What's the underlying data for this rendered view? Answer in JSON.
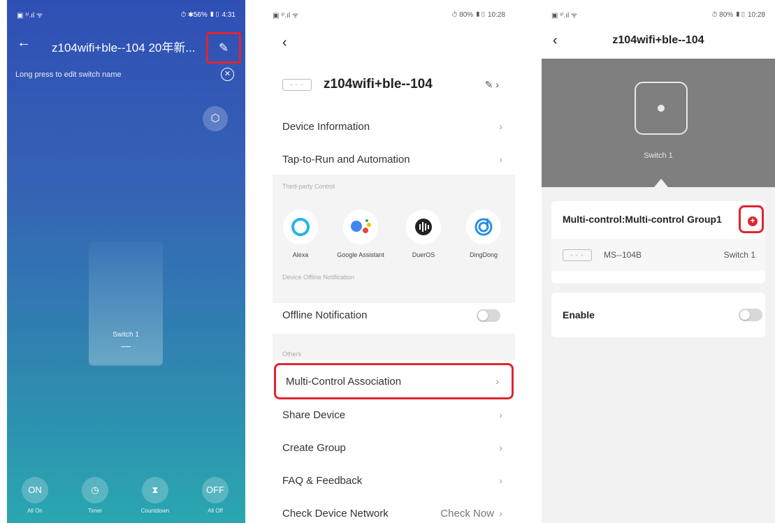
{
  "phone1": {
    "status_left": "▣ ˢⁱ.ıl ᯤ",
    "status_right": "⏱ ✱56% ▮▯ 4:31",
    "title": "z104wifi+ble--104 20年新...",
    "hint": "Long press to edit switch name",
    "switch_label": "Switch 1",
    "controls": [
      {
        "icon": "ON",
        "label": "All On"
      },
      {
        "icon": "◷",
        "label": "Timer"
      },
      {
        "icon": "⧗",
        "label": "Countdown"
      },
      {
        "icon": "OFF",
        "label": "All Off"
      }
    ],
    "colors": {
      "gradient_top": "#2f4fb5",
      "gradient_bottom": "#2aa7b0",
      "highlight": "#e0252f"
    }
  },
  "phone2": {
    "status_left": "▣ ˢⁱ.ıl ᯤ",
    "status_right": "⏱ 80% ▮▯ 10:28",
    "device_name": "z104wifi+ble--104",
    "rows_top": [
      {
        "label": "Device Information"
      },
      {
        "label": "Tap-to-Run and Automation"
      }
    ],
    "third_party_title": "Third-party Control",
    "third_party": [
      {
        "label": "Alexa"
      },
      {
        "label": "Google Assistant"
      },
      {
        "label": "DuerOS"
      },
      {
        "label": "DingDong"
      }
    ],
    "offline_title": "Device Offline Notification",
    "offline_row": "Offline Notification",
    "others_title": "Others",
    "rows_others": [
      {
        "label": "Multi-Control Association"
      },
      {
        "label": "Share Device"
      },
      {
        "label": "Create Group"
      },
      {
        "label": "FAQ & Feedback"
      },
      {
        "label": "Check Device Network",
        "value": "Check Now"
      }
    ]
  },
  "phone3": {
    "status_left": "▣ ˢⁱ.ıl ᯤ",
    "status_right": "⏱ 80% ▮▯ 10:28",
    "title": "z104wifi+ble--104",
    "switch_label": "Switch 1",
    "group_label": "Multi-control:Multi-control Group1",
    "sub_device_model": "MS--104B",
    "sub_device_switch": "Switch 1",
    "enable_label": "Enable"
  }
}
